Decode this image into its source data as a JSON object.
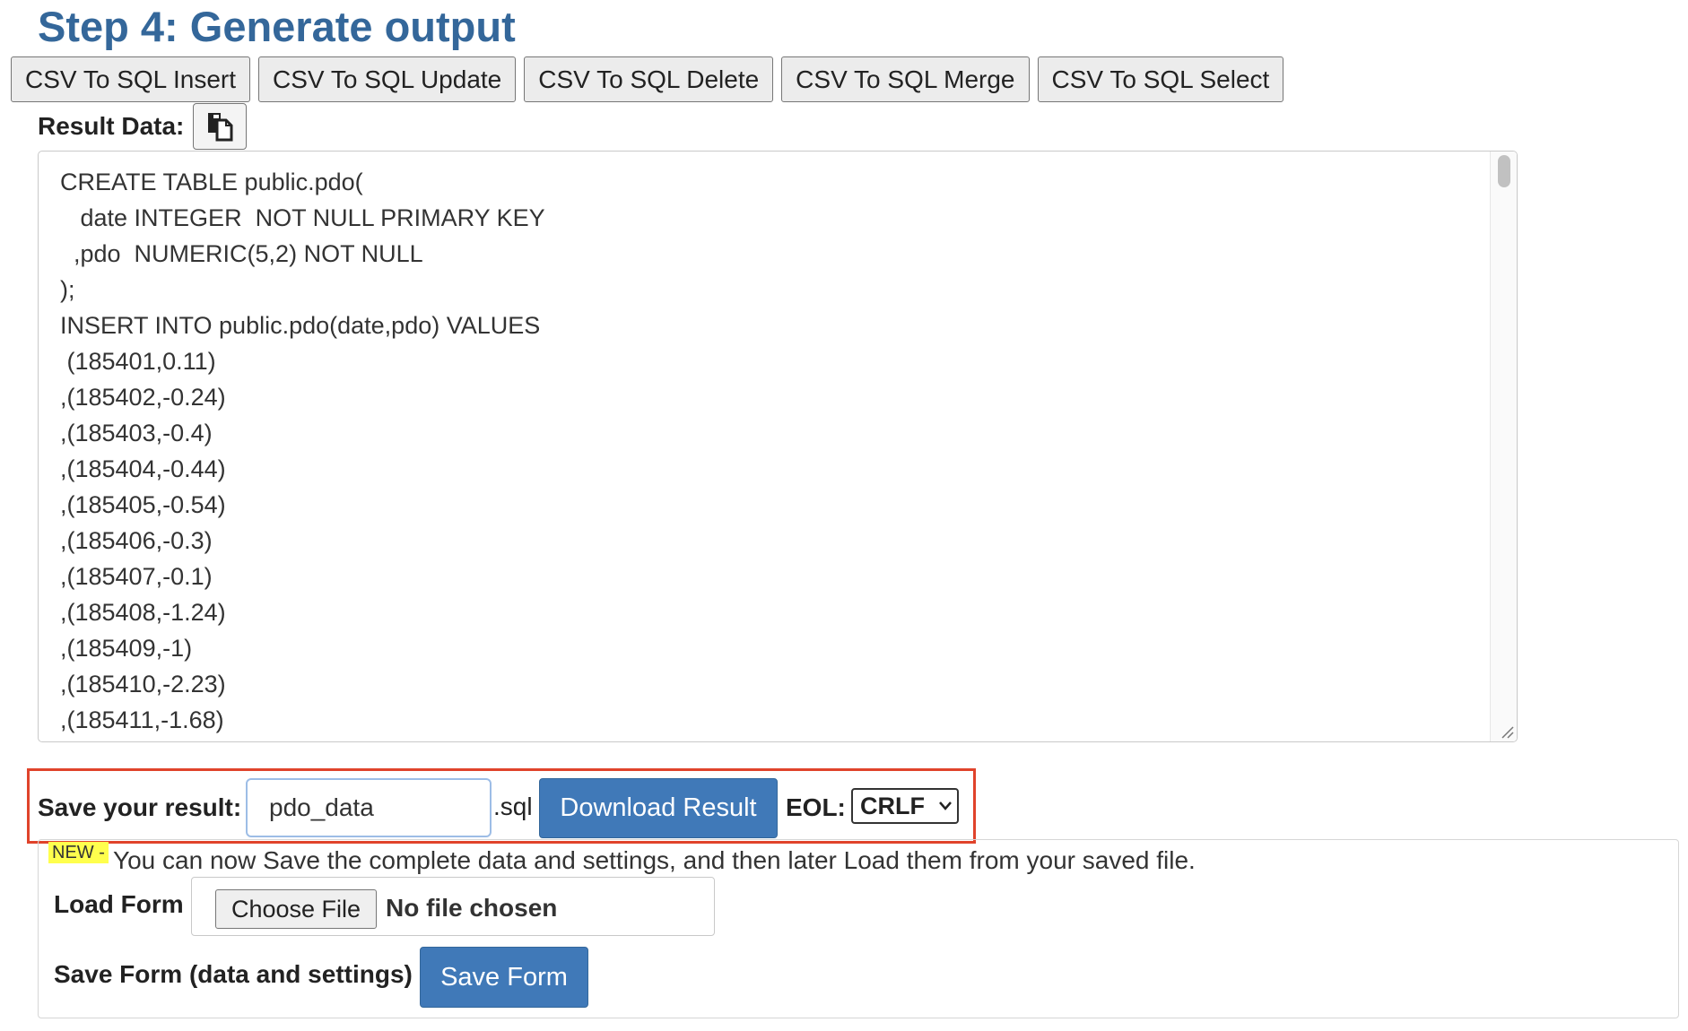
{
  "heading": "Step 4: Generate output",
  "conversion_buttons": [
    "CSV To SQL Insert",
    "CSV To SQL Update",
    "CSV To SQL Delete",
    "CSV To SQL Merge",
    "CSV To SQL Select"
  ],
  "result": {
    "label": "Result Data:",
    "copy_icon": "copy-icon",
    "lines": [
      "CREATE TABLE public.pdo(",
      "   date INTEGER  NOT NULL PRIMARY KEY",
      "  ,pdo  NUMERIC(5,2) NOT NULL",
      ");",
      "INSERT INTO public.pdo(date,pdo) VALUES",
      " (185401,0.11)",
      ",(185402,-0.24)",
      ",(185403,-0.4)",
      ",(185404,-0.44)",
      ",(185405,-0.54)",
      ",(185406,-0.3)",
      ",(185407,-0.1)",
      ",(185408,-1.24)",
      ",(185409,-1)",
      ",(185410,-2.23)",
      ",(185411,-1.68)"
    ]
  },
  "save": {
    "label": "Save your result:",
    "filename": "pdo_data",
    "extension": ".sql",
    "download_label": "Download Result",
    "eol_label": "EOL:",
    "eol_value": "CRLF",
    "highlight_color": "#e0432b"
  },
  "load_panel": {
    "new_badge": "NEW -",
    "new_text": "You can now Save the complete data and settings, and then later Load them from your saved file.",
    "load_label": "Load Form",
    "choose_file_label": "Choose File",
    "no_file_text": "No file chosen",
    "save_form_label": "Save Form (data and settings)",
    "save_form_button": "Save Form"
  },
  "colors": {
    "heading": "#34679a",
    "primary_button": "#4079b8"
  }
}
